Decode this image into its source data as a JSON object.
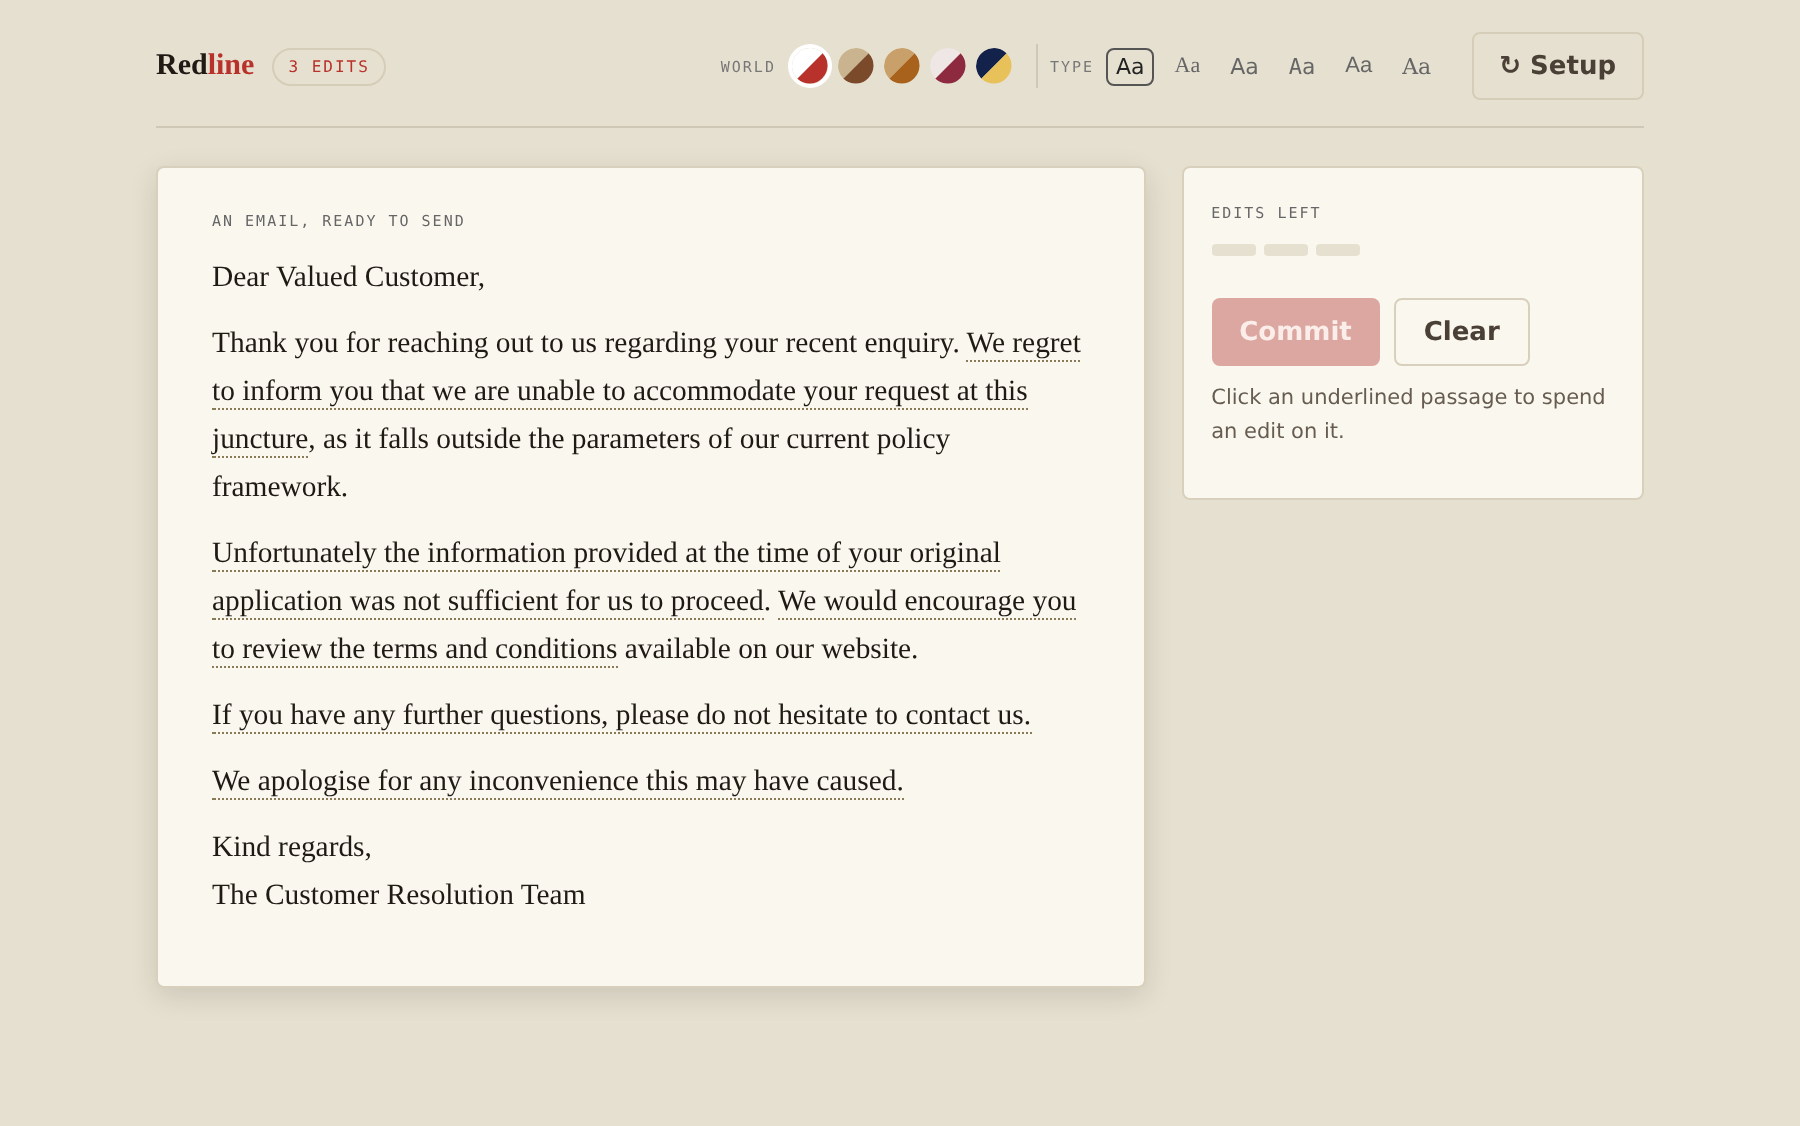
{
  "header": {
    "logo": [
      {
        "text": "Red",
        "kind": "plain"
      },
      {
        "text": "line",
        "kind": "accent"
      }
    ],
    "edits_badge": "3 EDITS",
    "world": {
      "label": "WORLD",
      "swatches": [
        {
          "halves": [
            {
              "color": "#ffffff"
            },
            {
              "color": "#b8312a"
            }
          ],
          "selected": true
        },
        {
          "halves": [
            {
              "color": "#c9b48f"
            },
            {
              "color": "#7a4a2a"
            }
          ],
          "selected": false
        },
        {
          "halves": [
            {
              "color": "#c9a06a"
            },
            {
              "color": "#a8621c"
            }
          ],
          "selected": false
        },
        {
          "halves": [
            {
              "color": "#efe6e6"
            },
            {
              "color": "#8e2a40"
            }
          ],
          "selected": false
        },
        {
          "halves": [
            {
              "color": "#13224a"
            },
            {
              "color": "#e8c15a"
            }
          ],
          "selected": false
        }
      ]
    },
    "type": {
      "label": "TYPE",
      "options": [
        {
          "text": "Aa",
          "selected": true
        },
        {
          "text": "Aa",
          "selected": false
        },
        {
          "text": "Aa",
          "selected": false
        },
        {
          "text": "Aa",
          "selected": false
        },
        {
          "text": "Aa",
          "selected": false
        },
        {
          "text": "Aa",
          "selected": false
        }
      ]
    },
    "setup_button": {
      "icon": "↻",
      "label": "Setup"
    }
  },
  "email": {
    "caption": "AN EMAIL, READY TO SEND",
    "paragraphs": [
      [
        {
          "kind": "plain",
          "text": "Dear Valued Customer,"
        }
      ],
      [
        {
          "kind": "plain",
          "text": "Thank you for reaching out to us regarding your recent enquiry. "
        },
        {
          "kind": "passage",
          "text": "We regret to inform you that we are unable to accommodate your request at this juncture"
        },
        {
          "kind": "plain",
          "text": ", as it falls outside the parameters of our current policy framework."
        }
      ],
      [
        {
          "kind": "passage",
          "text": "Unfortunately the information provided at the time of your original application was not sufficient for us to proceed"
        },
        {
          "kind": "plain",
          "text": ". "
        },
        {
          "kind": "passage",
          "text": "We would encourage you to review the terms and conditions"
        },
        {
          "kind": "plain",
          "text": " available on our website."
        }
      ],
      [
        {
          "kind": "passage",
          "text": "If you have any further questions, please do not hesitate to contact us."
        }
      ],
      [
        {
          "kind": "passage",
          "text": "We apologise for any inconvenience this may have caused."
        }
      ],
      [
        {
          "kind": "plain",
          "text": "Kind regards,"
        }
      ],
      [
        {
          "kind": "plain",
          "text": "The Customer Resolution Team"
        }
      ]
    ]
  },
  "panel": {
    "edits_left": {
      "label": "EDITS LEFT",
      "slots": [
        {
          "used": false
        },
        {
          "used": false
        },
        {
          "used": false
        }
      ]
    },
    "commit_button": {
      "label": "Commit",
      "disabled": true
    },
    "clear_button": {
      "label": "Clear",
      "disabled": false
    },
    "hint": "Click an underlined passage to spend an edit on it."
  }
}
